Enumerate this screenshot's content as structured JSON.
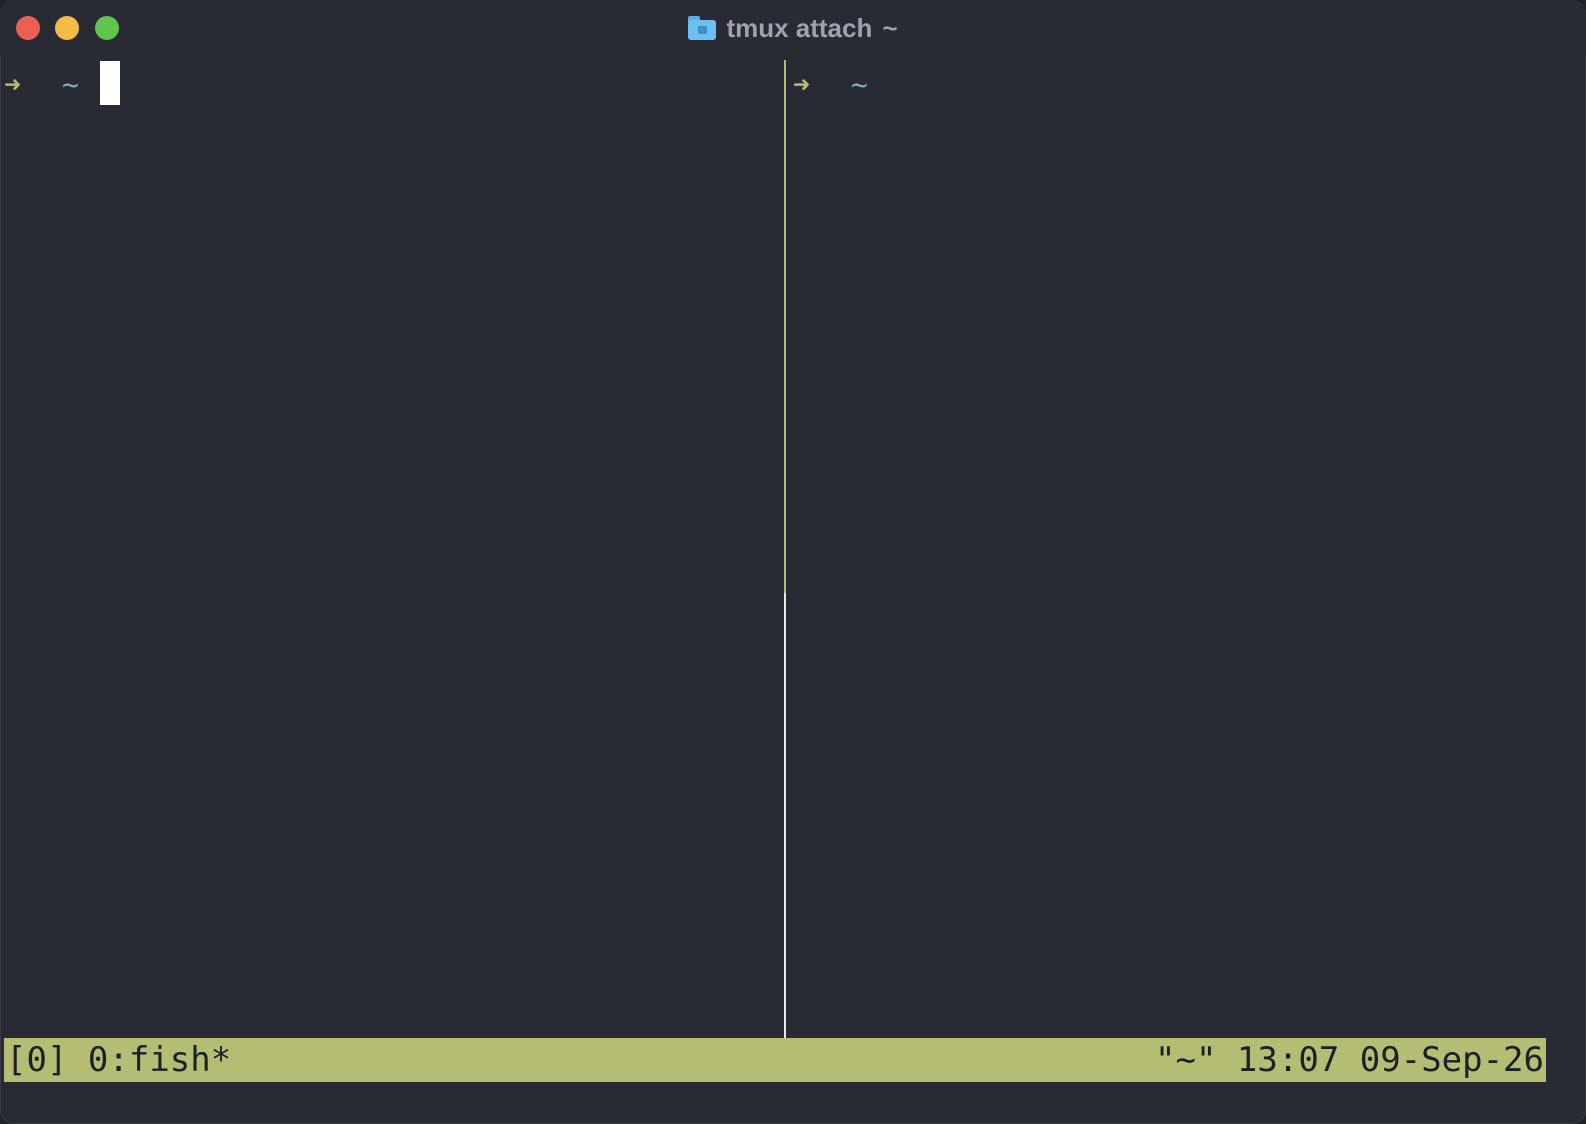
{
  "window": {
    "title": "tmux attach",
    "title_suffix": "~",
    "icon": "home-folder-icon"
  },
  "traffic_lights": [
    {
      "name": "close",
      "color": "#ec5f57"
    },
    {
      "name": "minimize",
      "color": "#f3bc47"
    },
    {
      "name": "zoom",
      "color": "#5fc54e"
    }
  ],
  "panes": [
    {
      "id": "left",
      "prompt_symbol": "➜",
      "cwd": "~",
      "has_cursor": true,
      "active": true
    },
    {
      "id": "right",
      "prompt_symbol": "➜",
      "cwd": "~",
      "has_cursor": false,
      "active": false
    }
  ],
  "statusbar": {
    "session": "[0]",
    "window_list": "0:fish*",
    "pane_title": "\"~\"",
    "time": "13:07",
    "date": "09-Sep-26",
    "background": "#b5bd74"
  },
  "colors": {
    "background": "#282b34",
    "prompt_arrow": "#b5bd6f",
    "prompt_cwd": "#79b4b2",
    "active_border": "#b5bd6f"
  }
}
